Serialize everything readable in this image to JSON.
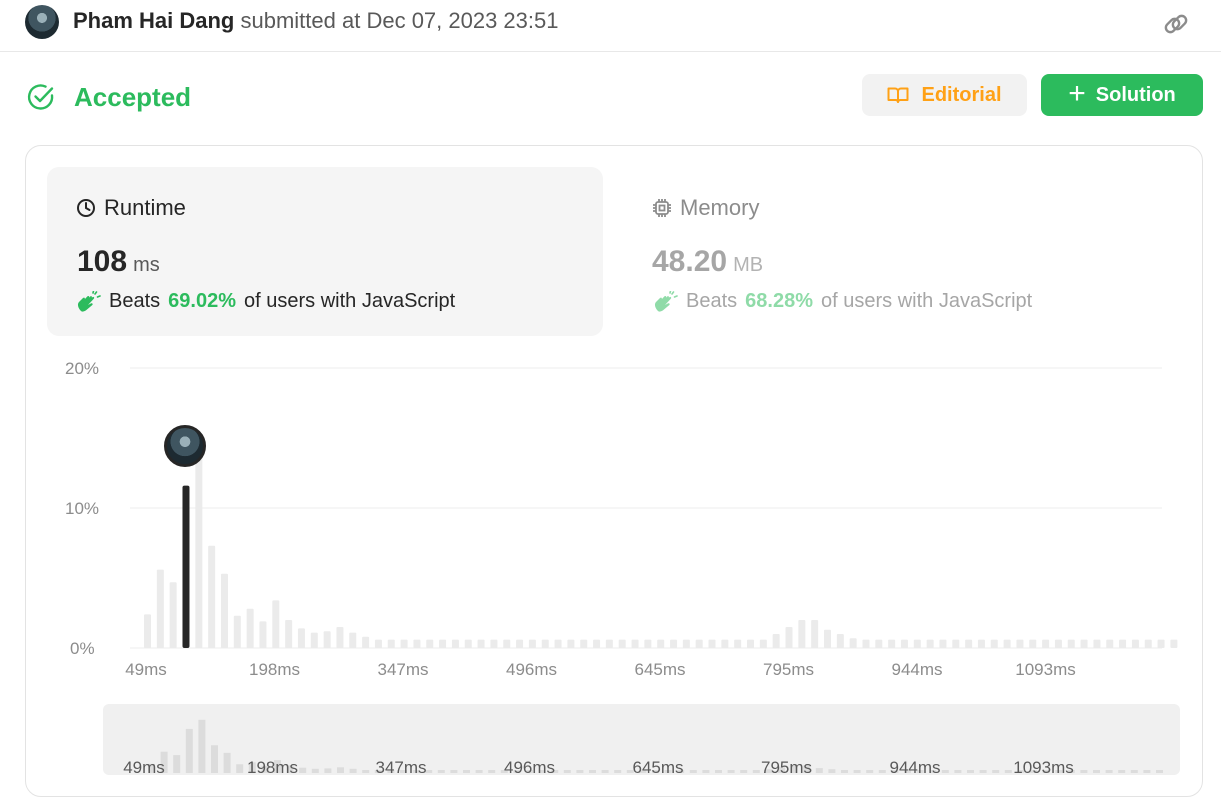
{
  "header": {
    "user_name": "Pham Hai Dang",
    "submitted_text": "submitted at Dec 07, 2023 23:51",
    "link_icon": "link-icon"
  },
  "result": {
    "status": "Accepted",
    "status_color": "#2cbb5d",
    "editorial_label": "Editorial",
    "solution_label": "Solution"
  },
  "runtime": {
    "title": "Runtime",
    "value": "108",
    "unit": "ms",
    "beats_prefix": "Beats",
    "beats_pct": "69.02%",
    "beats_suffix": "of users with JavaScript"
  },
  "memory": {
    "title": "Memory",
    "value": "48.20",
    "unit": "MB",
    "beats_prefix": "Beats",
    "beats_pct": "68.28%",
    "beats_suffix": "of users with JavaScript"
  },
  "chart_data": {
    "type": "bar",
    "y_ticks": [
      "20%",
      "10%",
      "0%"
    ],
    "ylim": [
      0,
      20
    ],
    "x_tick_labels": [
      "49ms",
      "198ms",
      "347ms",
      "496ms",
      "645ms",
      "795ms",
      "944ms",
      "1093ms"
    ],
    "highlighted_bin": 3,
    "values": [
      2.4,
      5.6,
      4.7,
      11.6,
      14.0,
      7.3,
      5.3,
      2.3,
      2.8,
      1.9,
      3.4,
      2.0,
      1.4,
      1.1,
      1.2,
      1.5,
      1.1,
      0.8,
      0.6,
      0.6,
      0.6,
      0.6,
      0.6,
      0.6,
      0.6,
      0.6,
      0.6,
      0.6,
      0.6,
      0.6,
      0.6,
      0.6,
      0.6,
      0.6,
      0.6,
      0.6,
      0.6,
      0.6,
      0.6,
      0.6,
      0.6,
      0.6,
      0.6,
      0.6,
      0.6,
      0.6,
      0.6,
      0.6,
      0.6,
      1.0,
      1.5,
      2.0,
      2.0,
      1.3,
      1.0,
      0.7,
      0.6,
      0.6,
      0.6,
      0.6,
      0.6,
      0.6,
      0.6,
      0.6,
      0.6,
      0.6,
      0.6,
      0.6,
      0.6,
      0.6,
      0.6,
      0.6,
      0.6,
      0.6,
      0.6,
      0.6,
      0.6,
      0.6,
      0.6,
      0.6,
      0.6
    ],
    "bar_color": "#ebebeb",
    "highlight_color": "#262626"
  }
}
